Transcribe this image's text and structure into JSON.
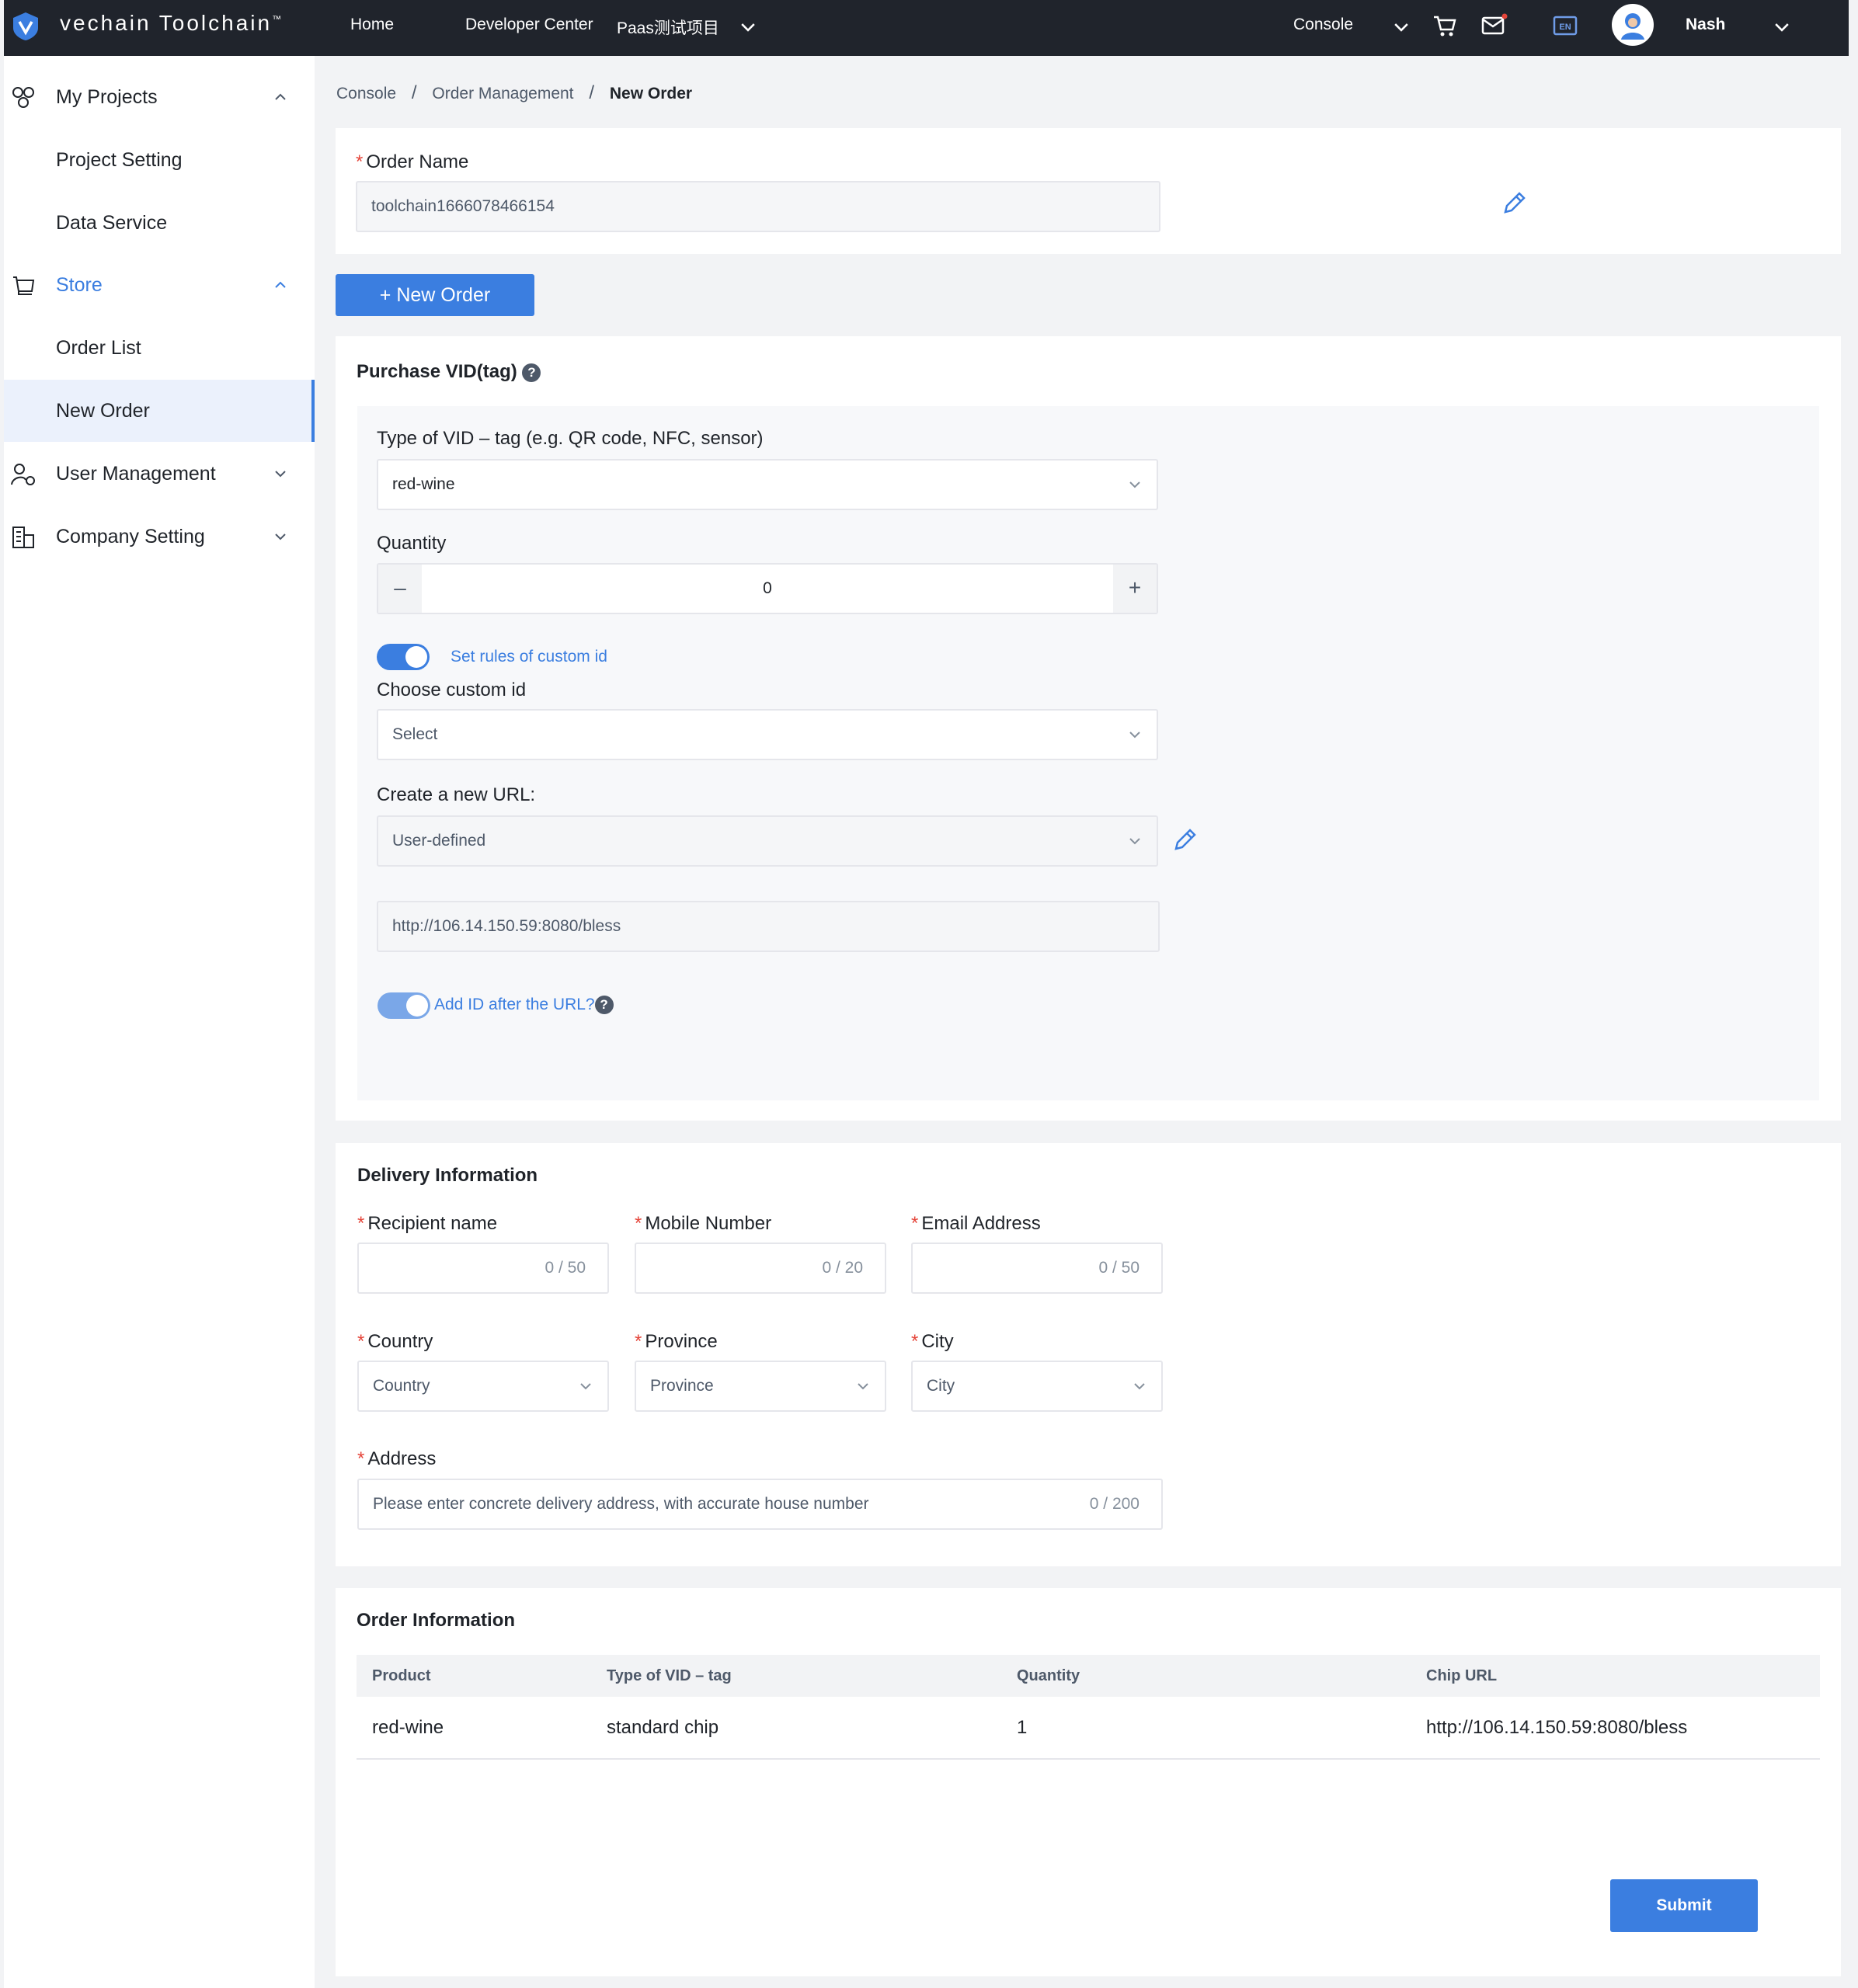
{
  "topbar": {
    "brand": "vechain Toolchain",
    "brand_tm": "™",
    "nav": [
      "Home",
      "Developer Center",
      "Paas测试项目"
    ],
    "console": "Console",
    "lang": "EN",
    "user": "Nash"
  },
  "sidebar": {
    "my_projects": "My Projects",
    "project_setting": "Project Setting",
    "data_service": "Data Service",
    "store": "Store",
    "order_list": "Order List",
    "new_order": "New Order",
    "user_management": "User Management",
    "company_setting": "Company Setting"
  },
  "breadcrumb": {
    "items": [
      "Console",
      "Order Management",
      "New Order"
    ],
    "separator": "/"
  },
  "order_name": {
    "label": "Order Name",
    "value": "toolchain1666078466154"
  },
  "new_order_button": "+ New Order",
  "purchase": {
    "title": "Purchase VID(tag)",
    "type_label": "Type of VID – tag   (e.g. QR code, NFC, sensor)",
    "type_value": "red-wine",
    "quantity_label": "Quantity",
    "quantity_value": "0",
    "minus": "–",
    "plus": "+",
    "custom_id_toggle": "Set rules of custom id",
    "choose_custom_id_label": "Choose custom id",
    "choose_custom_id_placeholder": "Select",
    "create_url_label": "Create a new URL:",
    "create_url_value": "User-defined",
    "url_value": "http://106.14.150.59:8080/bless",
    "add_id_toggle": "Add ID after the URL?"
  },
  "delivery": {
    "title": "Delivery Information",
    "recipient_label": "Recipient name",
    "recipient_count": "0 / 50",
    "mobile_label": "Mobile Number",
    "mobile_count": "0 / 20",
    "email_label": "Email Address",
    "email_count": "0 / 50",
    "country_label": "Country",
    "country_placeholder": "Country",
    "province_label": "Province",
    "province_placeholder": "Province",
    "city_label": "City",
    "city_placeholder": "City",
    "address_label": "Address",
    "address_placeholder": "Please enter concrete delivery address, with accurate house number",
    "address_count": "0 / 200"
  },
  "order_info": {
    "title": "Order Information",
    "columns": [
      "Product",
      "Type of VID – tag",
      "Quantity",
      "Chip URL"
    ],
    "rows": [
      [
        "red-wine",
        "standard chip",
        "1",
        "http://106.14.150.59:8080/bless"
      ]
    ]
  },
  "submit": "Submit",
  "colors": {
    "accent": "#3b7ee0",
    "topbar": "#20242c",
    "required": "#e5453a"
  }
}
